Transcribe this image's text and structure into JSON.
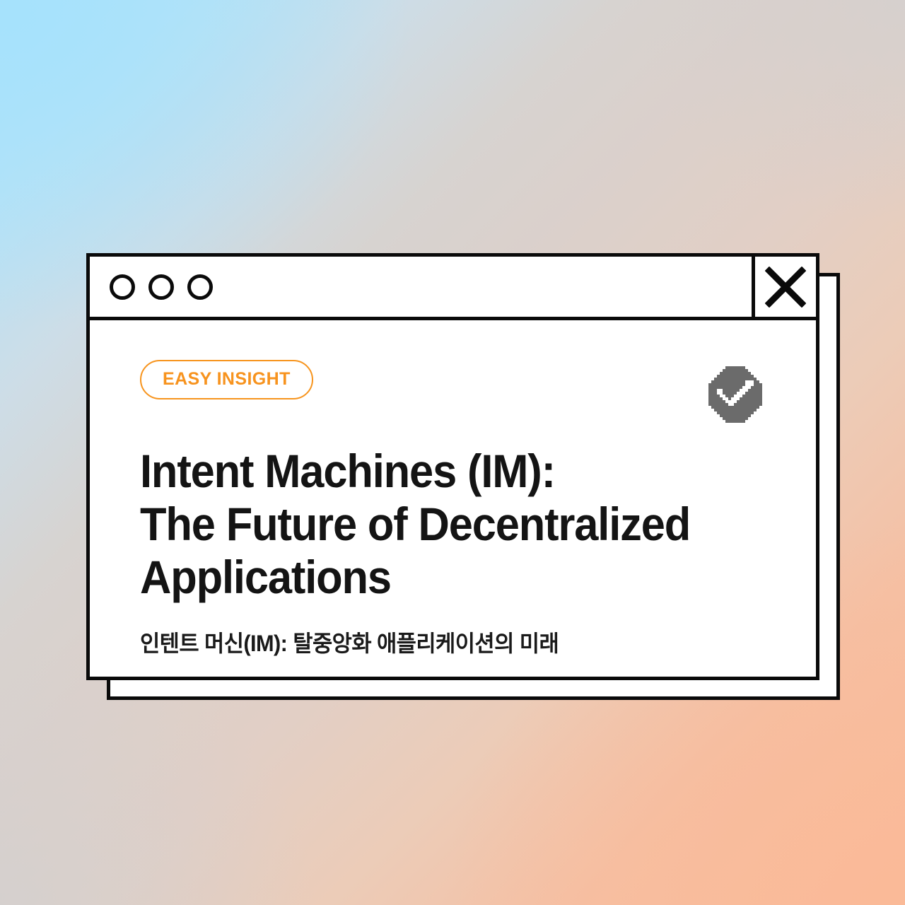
{
  "background": {
    "gradient_from": "#a9e1fb",
    "gradient_mid": "#d7d3d0",
    "gradient_to": "#fabb9b"
  },
  "window": {
    "titlebar": {
      "dots": [
        {
          "name": "window-dot-1"
        },
        {
          "name": "window-dot-2"
        },
        {
          "name": "window-dot-3"
        }
      ],
      "close_icon": "close-x-icon"
    },
    "content": {
      "badge": {
        "label": "EASY INSIGHT",
        "color": "#f7931e"
      },
      "verified_icon": {
        "name": "verified-check-badge-icon",
        "color": "#6b6b6b"
      },
      "headline": "Intent Machines (IM):\nThe Future of Decentralized\nApplications",
      "subtitle": "인텐트 머신(IM): 탈중앙화 애플리케이션의 미래"
    }
  }
}
